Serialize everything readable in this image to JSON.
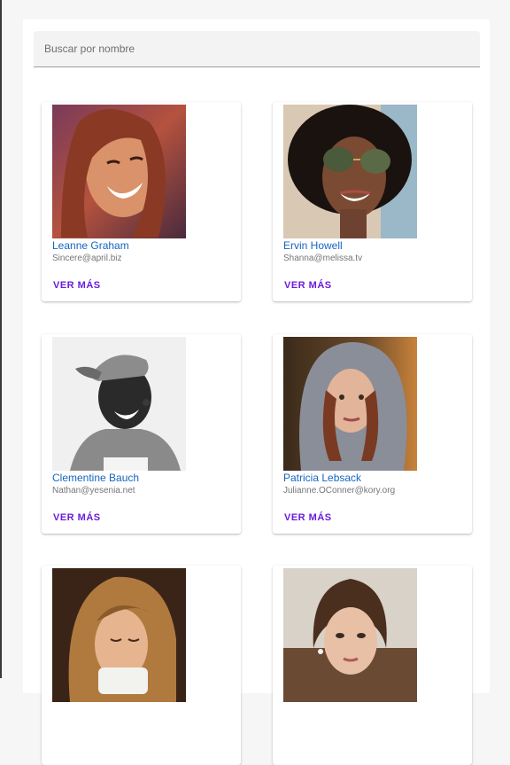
{
  "search": {
    "placeholder": "Buscar por nombre",
    "value": ""
  },
  "cards": [
    {
      "name": "Leanne Graham",
      "email": "Sincere@april.biz",
      "button": "VER MÁS"
    },
    {
      "name": "Ervin Howell",
      "email": "Shanna@melissa.tv",
      "button": "VER MÁS"
    },
    {
      "name": "Clementine Bauch",
      "email": "Nathan@yesenia.net",
      "button": "VER MÁS"
    },
    {
      "name": "Patricia Lebsack",
      "email": "Julianne.OConner@kory.org",
      "button": "VER MÁS"
    },
    {
      "name": "",
      "email": "",
      "button": ""
    },
    {
      "name": "",
      "email": "",
      "button": ""
    }
  ],
  "colors": {
    "name_link": "#1565c0",
    "button": "#6a1bdb",
    "email": "#757575"
  }
}
